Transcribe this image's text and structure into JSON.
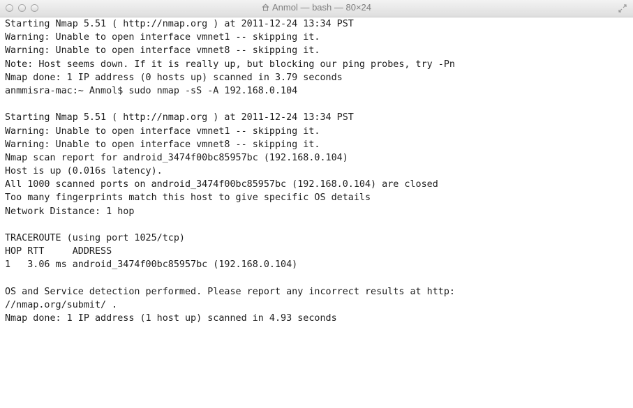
{
  "window": {
    "title": "Anmol — bash — 80×24"
  },
  "icons": {
    "title_icon": "home-folder-icon",
    "resize_icon": "fullscreen-arrows-icon"
  },
  "colors": {
    "text": "#1e1e1e",
    "background": "#ffffff",
    "title_text": "#7f7f7f"
  },
  "terminal": {
    "lines": [
      "Starting Nmap 5.51 ( http://nmap.org ) at 2011-12-24 13:34 PST",
      "Warning: Unable to open interface vmnet1 -- skipping it.",
      "Warning: Unable to open interface vmnet8 -- skipping it.",
      "Note: Host seems down. If it is really up, but blocking our ping probes, try -Pn",
      "Nmap done: 1 IP address (0 hosts up) scanned in 3.79 seconds",
      "anmmisra-mac:~ Anmol$ sudo nmap -sS -A 192.168.0.104",
      "",
      "Starting Nmap 5.51 ( http://nmap.org ) at 2011-12-24 13:34 PST",
      "Warning: Unable to open interface vmnet1 -- skipping it.",
      "Warning: Unable to open interface vmnet8 -- skipping it.",
      "Nmap scan report for android_3474f00bc85957bc (192.168.0.104)",
      "Host is up (0.016s latency).",
      "All 1000 scanned ports on android_3474f00bc85957bc (192.168.0.104) are closed",
      "Too many fingerprints match this host to give specific OS details",
      "Network Distance: 1 hop",
      "",
      "TRACEROUTE (using port 1025/tcp)",
      "HOP RTT     ADDRESS",
      "1   3.06 ms android_3474f00bc85957bc (192.168.0.104)",
      "",
      "OS and Service detection performed. Please report any incorrect results at http:",
      "//nmap.org/submit/ .",
      "Nmap done: 1 IP address (1 host up) scanned in 4.93 seconds"
    ]
  }
}
